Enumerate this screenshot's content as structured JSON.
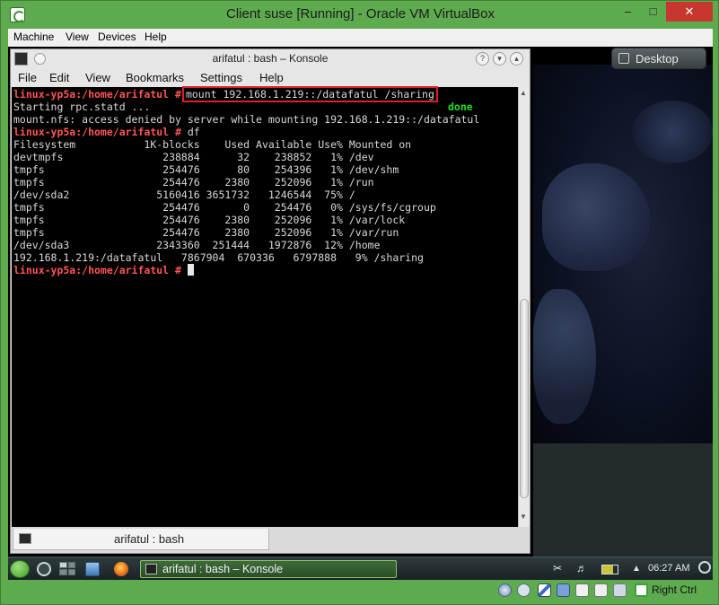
{
  "host": {
    "title": "Client suse [Running] - Oracle VM VirtualBox",
    "controls": {
      "minimize": "–",
      "maximize": "□",
      "close": "✕"
    },
    "menu": [
      "Machine",
      "View",
      "Devices",
      "Help"
    ],
    "status": {
      "host_key": "Right Ctrl"
    }
  },
  "desktop": {
    "button_label": "Desktop"
  },
  "konsole": {
    "title": "arifatul : bash – Konsole",
    "menu": [
      "File",
      "Edit",
      "View",
      "Bookmarks",
      "Settings",
      "Help"
    ],
    "tab_label": "arifatul : bash",
    "terminal": {
      "prompt": "linux-yp5a:/home/arifatul #",
      "highlighted_command": "mount 192.168.1.219::/datafatul /sharing",
      "line_starting": "Starting rpc.statd ...",
      "done_label": "done",
      "line_error": "mount.nfs: access denied by server while mounting 192.168.1.219::/datafatul",
      "command_df": " df",
      "df_header": "Filesystem           1K-blocks    Used Available Use% Mounted on",
      "df_rows": [
        "devtmpfs                238884      32    238852   1% /dev",
        "tmpfs                   254476      80    254396   1% /dev/shm",
        "tmpfs                   254476    2380    252096   1% /run",
        "/dev/sda2              5160416 3651732   1246544  75% /",
        "tmpfs                   254476       0    254476   0% /sys/fs/cgroup",
        "tmpfs                   254476    2380    252096   1% /var/lock",
        "tmpfs                   254476    2380    252096   1% /var/run",
        "/dev/sda3              2343360  251444   1972876  12% /home",
        "192.168.1.219:/datafatul   7867904  670336   6797888   9% /sharing"
      ]
    }
  },
  "panel": {
    "task_label": "arifatul : bash – Konsole",
    "clock": "06:27 AM",
    "icons": [
      "kde-start-icon",
      "cashew-icon",
      "pager-icon",
      "dolphin-icon",
      "firefox-icon",
      "scissors-icon",
      "volume-icon",
      "battery-icon",
      "expand-arrow-icon",
      "cashew-icon"
    ]
  },
  "colors": {
    "host_frame": "#5eab4f",
    "close_button": "#c7372f",
    "prompt": "#ff5555",
    "done": "#22dd22",
    "highlight_box": "#e02020"
  }
}
